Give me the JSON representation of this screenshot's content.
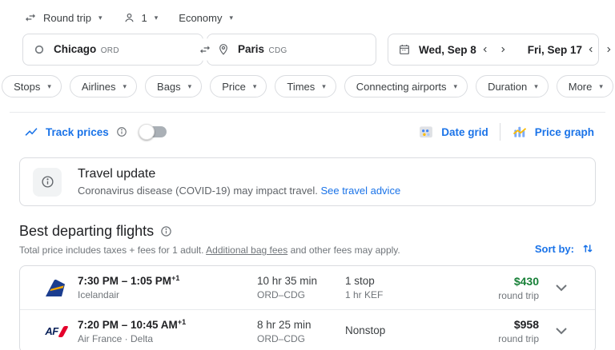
{
  "topbar": {
    "trip_type": "Round trip",
    "passenger_count": "1",
    "cabin_class": "Economy"
  },
  "search": {
    "origin_city": "Chicago",
    "origin_code": "ORD",
    "destination_city": "Paris",
    "destination_code": "CDG",
    "depart_date": "Wed, Sep 8",
    "return_date": "Fri, Sep 17"
  },
  "filters": {
    "chips": [
      "Stops",
      "Airlines",
      "Bags",
      "Price",
      "Times",
      "Connecting airports",
      "Duration",
      "More"
    ]
  },
  "tools": {
    "track_prices": "Track prices",
    "date_grid": "Date grid",
    "price_graph": "Price graph"
  },
  "banner": {
    "title": "Travel update",
    "message": "Coronavirus disease (COVID-19) may impact travel.",
    "link": "See travel advice"
  },
  "results": {
    "heading": "Best departing flights",
    "subtitle_prefix": "Total price includes taxes + fees for 1 adult.",
    "subtitle_link": "Additional bag fees",
    "subtitle_suffix": "and other fees may apply.",
    "sort_label": "Sort by:"
  },
  "flights": [
    {
      "airline": "Icelandair",
      "logo": "icelandair-tail",
      "times": "7:30 PM – 1:05 PM",
      "plus_days": "+1",
      "duration": "10 hr 35 min",
      "route": "ORD–CDG",
      "stops": "1 stop",
      "stop_detail": "1 hr KEF",
      "price": "$430",
      "price_color": "#188038",
      "price_note": "round trip"
    },
    {
      "airline": "Air France · Delta",
      "logo": "air-france",
      "logo_text": "AF",
      "times": "7:20 PM – 10:45 AM",
      "plus_days": "+1",
      "duration": "8 hr 25 min",
      "route": "ORD–CDG",
      "stops": "Nonstop",
      "stop_detail": "",
      "price": "$958",
      "price_color": "#202124",
      "price_note": "round trip"
    }
  ],
  "icons": {
    "dropdown": "▾"
  },
  "colors": {
    "accent_blue": "#1a73e8",
    "price_green": "#188038",
    "text_dark": "#202124",
    "text_gray": "#70757a",
    "border": "#dadce0",
    "logo_yellow": "#fbbc04",
    "af_navy": "#051e57",
    "af_red": "#e4002b"
  }
}
